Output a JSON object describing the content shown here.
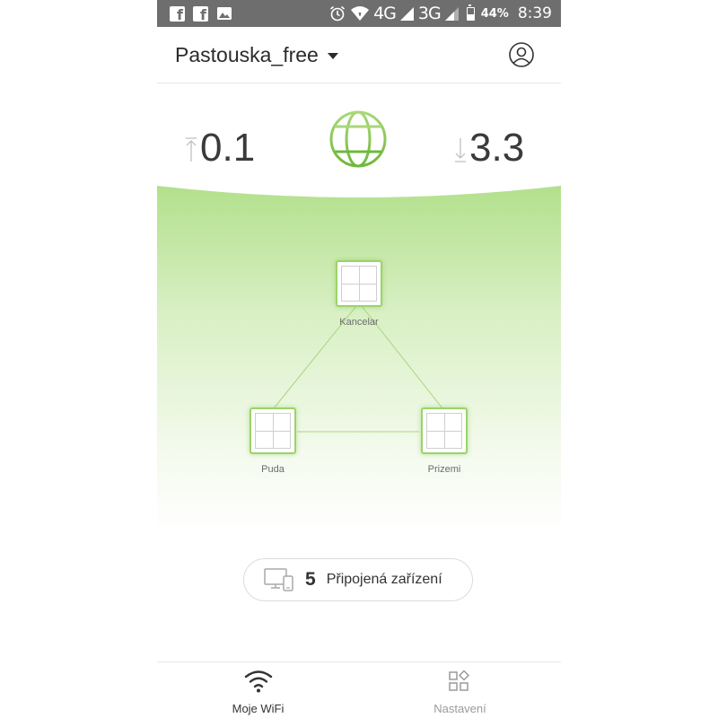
{
  "status_bar": {
    "network_4g": "4G",
    "network_3g": "3G",
    "battery_percent": "44%",
    "battery_level": 0.44,
    "time": "8:39",
    "icons": [
      "facebook-icon",
      "facebook-icon",
      "gallery-icon",
      "alarm-icon",
      "wifi-icon",
      "signal-icon",
      "battery-icon"
    ]
  },
  "header": {
    "network_name": "Pastouska_free",
    "icons": [
      "chevron-down-icon",
      "account-icon"
    ]
  },
  "speed": {
    "upload": "0.1",
    "download": "3.3",
    "icons": [
      "upload-arrow-icon",
      "globe-icon",
      "download-arrow-icon"
    ]
  },
  "mesh": {
    "nodes": [
      {
        "label": "Kancelar"
      },
      {
        "label": "Puda"
      },
      {
        "label": "Prizemi"
      }
    ]
  },
  "devices": {
    "count": "5",
    "label": "Připojená zařízení",
    "icon": "devices-icon"
  },
  "nav": {
    "wifi_label": "Moje WiFi",
    "settings_label": "Nastavení",
    "icons": [
      "wifi-icon",
      "settings-grid-icon"
    ]
  },
  "colors": {
    "accent_green": "#8cc84b",
    "status_bar": "#6e6e6e",
    "text_dark": "#333333",
    "text_muted": "#9a9a9a"
  }
}
